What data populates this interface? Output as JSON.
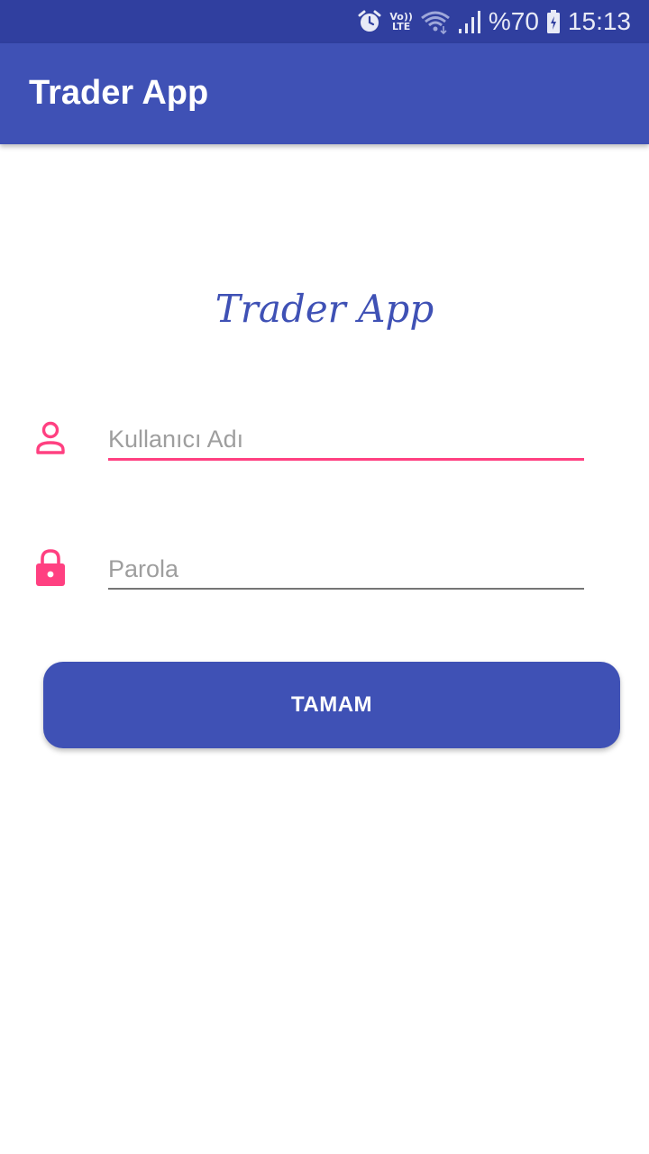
{
  "status_bar": {
    "icons": [
      "alarm-icon",
      "volte-icon",
      "wifi-icon",
      "signal-icon",
      "battery-icon"
    ],
    "volte_line1": "Vo))",
    "volte_line2": "LTE",
    "battery": "%70",
    "time": "15:13"
  },
  "app_bar": {
    "title": "Trader App"
  },
  "logo": {
    "text": "Trader App"
  },
  "form": {
    "username_placeholder": "Kullanıcı Adı",
    "username_icon": "person-icon",
    "password_placeholder": "Parola",
    "password_icon": "lock-icon",
    "submit_label": "TAMAM"
  },
  "colors": {
    "primary": "#3f51b5",
    "primary_dark": "#303f9f",
    "accent": "#ff4081"
  }
}
